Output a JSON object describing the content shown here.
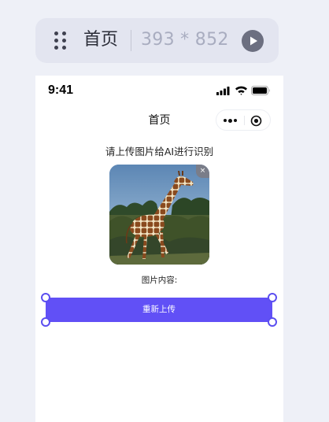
{
  "toolbar": {
    "page_title": "首页",
    "device_size": "393 * 852",
    "icons": [
      "drag-handle-icon",
      "play-icon"
    ]
  },
  "status_bar": {
    "time": "9:41",
    "icons": [
      "signal-icon",
      "wifi-icon",
      "battery-icon"
    ]
  },
  "nav": {
    "title": "首页",
    "capsule_icons": [
      "more-icon",
      "close-circle-icon"
    ]
  },
  "content": {
    "instruction": "请上传图片给AI进行识别",
    "preview_image": "giraffe-photo",
    "remove_badge": "×",
    "result_label": "图片内容:",
    "reupload_label": "重新上传"
  },
  "colors": {
    "accent": "#6150f6",
    "canvas_bg": "#eef0f7",
    "toolbar_bg": "#e3e5f0"
  }
}
